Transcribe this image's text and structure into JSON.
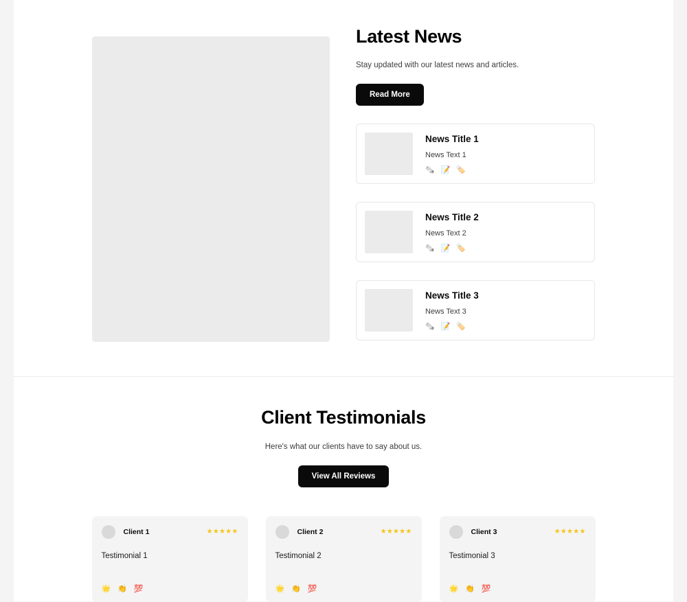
{
  "news": {
    "title": "Latest News",
    "subtitle": "Stay updated with our latest news and articles.",
    "cta_label": "Read More",
    "cards": [
      {
        "title": "News Title 1",
        "text": "News Text 1",
        "emojis": [
          "🗞️",
          "📝",
          "🏷️"
        ]
      },
      {
        "title": "News Title 2",
        "text": "News Text 2",
        "emojis": [
          "🗞️",
          "📝",
          "🏷️"
        ]
      },
      {
        "title": "News Title 3",
        "text": "News Text 3",
        "emojis": [
          "🗞️",
          "📝",
          "🏷️"
        ]
      }
    ]
  },
  "testimonials": {
    "title": "Client Testimonials",
    "subtitle": "Here's what our clients have to say about us.",
    "cta_label": "View All Reviews",
    "cards": [
      {
        "name": "Client 1",
        "text": "Testimonial 1",
        "stars": "★★★★★",
        "emojis": [
          "🌟",
          "👏",
          "💯"
        ]
      },
      {
        "name": "Client 2",
        "text": "Testimonial 2",
        "stars": "★★★★★",
        "emojis": [
          "🌟",
          "👏",
          "💯"
        ]
      },
      {
        "name": "Client 3",
        "text": "Testimonial 3",
        "stars": "★★★★★",
        "emojis": [
          "🌟",
          "👏",
          "💯"
        ]
      }
    ]
  },
  "colors": {
    "page_background": "#f4f4f5",
    "content_background": "#ffffff",
    "button": "#0a0a0a",
    "placeholder": "#ebebeb",
    "card_surface": "#f4f4f5",
    "star": "#f5c518",
    "avatar": "#d9d9d9"
  }
}
